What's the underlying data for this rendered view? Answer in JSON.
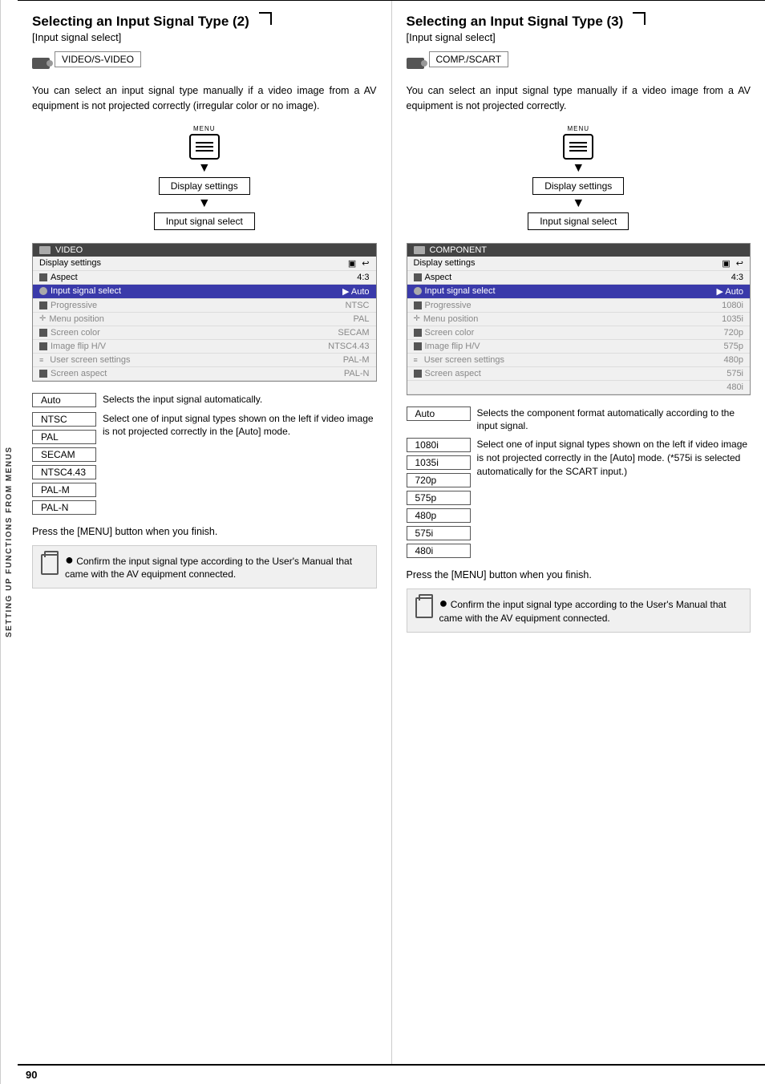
{
  "page": {
    "number": "90",
    "sidebar_label": "SETTING UP FUNCTIONS FROM MENUS"
  },
  "left": {
    "title": "Selecting an Input Signal Type (2)",
    "subtitle": "[Input signal select]",
    "input_type": "VIDEO/S-VIDEO",
    "body_text": "You can select an input signal type manually if a video image from a AV equipment is not projected correctly (irregular color or no image).",
    "menu_label": "MENU",
    "flow_items": [
      "Display settings",
      "Input signal select"
    ],
    "menu_screen": {
      "header": "VIDEO",
      "rows": [
        {
          "label": "Display settings",
          "value": "",
          "icons": [
            "monitor",
            "back"
          ],
          "type": "header"
        },
        {
          "label": "Aspect",
          "value": "4:3",
          "icon": "square"
        },
        {
          "label": "Input signal select",
          "value": "▶ Auto",
          "icon": "circle",
          "highlight": true
        },
        {
          "label": "Progressive",
          "value": "NTSC",
          "icon": "square",
          "dimmed": true
        },
        {
          "label": "Menu position",
          "value": "PAL",
          "icon": "nav",
          "dimmed": true
        },
        {
          "label": "Screen color",
          "value": "SECAM",
          "icon": "square",
          "dimmed": true
        },
        {
          "label": "Image flip H/V",
          "value": "NTSC4.43",
          "icon": "square",
          "dimmed": true
        },
        {
          "label": "User screen settings",
          "value": "PAL-M",
          "icon": "list",
          "dimmed": true
        },
        {
          "label": "Screen aspect",
          "value": "PAL-N",
          "icon": "square",
          "dimmed": true
        }
      ]
    },
    "options": [
      "Auto",
      "NTSC",
      "PAL",
      "SECAM",
      "NTSC4.43",
      "PAL-M",
      "PAL-N"
    ],
    "descriptions": [
      {
        "key": "Auto",
        "value": "Selects the input signal automatically."
      },
      {
        "key": "NTSC\nPAL",
        "value": "Select one of input signal types shown on the left if video image is not projected correctly in the [Auto] mode."
      },
      {
        "key": "SECAM",
        "value": ""
      },
      {
        "key": "NTSC4.43",
        "value": ""
      },
      {
        "key": "PAL-M",
        "value": ""
      },
      {
        "key": "PAL-N",
        "value": ""
      }
    ],
    "press_menu": "Press the [MENU] button when you finish.",
    "note": "Confirm the input signal type according to the User's Manual that came with the AV equipment connected."
  },
  "right": {
    "title": "Selecting an Input Signal Type (3)",
    "subtitle": "[Input signal select]",
    "input_type": "COMP./SCART",
    "body_text": "You can select an input signal type manually if a video image from a AV equipment is not projected correctly.",
    "menu_label": "MENU",
    "flow_items": [
      "Display settings",
      "Input signal select"
    ],
    "menu_screen": {
      "header": "COMPONENT",
      "rows": [
        {
          "label": "Display settings",
          "value": "",
          "icons": [
            "monitor",
            "back"
          ],
          "type": "header"
        },
        {
          "label": "Aspect",
          "value": "4:3",
          "icon": "square"
        },
        {
          "label": "Input signal select",
          "value": "▶ Auto",
          "icon": "circle",
          "highlight": true
        },
        {
          "label": "Progressive",
          "value": "1080i",
          "icon": "square",
          "dimmed": true
        },
        {
          "label": "Menu position",
          "value": "1035i",
          "icon": "nav",
          "dimmed": true
        },
        {
          "label": "Screen color",
          "value": "720p",
          "icon": "square",
          "dimmed": true
        },
        {
          "label": "Image flip H/V",
          "value": "575p",
          "icon": "square",
          "dimmed": true
        },
        {
          "label": "User screen settings",
          "value": "480p",
          "icon": "list",
          "dimmed": true
        },
        {
          "label": "Screen aspect",
          "value": "575i",
          "icon": "square",
          "dimmed": true
        },
        {
          "label": "",
          "value": "480i",
          "dimmed": true
        }
      ]
    },
    "options": [
      "Auto",
      "1080i",
      "1035i",
      "720p",
      "575p",
      "480p",
      "575i",
      "480i"
    ],
    "descriptions": [
      {
        "key": "Auto",
        "value": "Selects the component format automatically according to the input signal."
      },
      {
        "key": "1080i\n1035i\n720p",
        "value": "Select one of input signal types shown on the left if video image is not projected correctly in the [Auto] mode. (*575i is selected automatically for the SCART input.)"
      },
      {
        "key": "575p",
        "value": ""
      },
      {
        "key": "480p",
        "value": ""
      },
      {
        "key": "575i",
        "value": ""
      },
      {
        "key": "480i",
        "value": ""
      }
    ],
    "press_menu": "Press the [MENU] button when you finish.",
    "note": "Confirm the input signal type according to the User's Manual that came with the AV equipment connected."
  }
}
